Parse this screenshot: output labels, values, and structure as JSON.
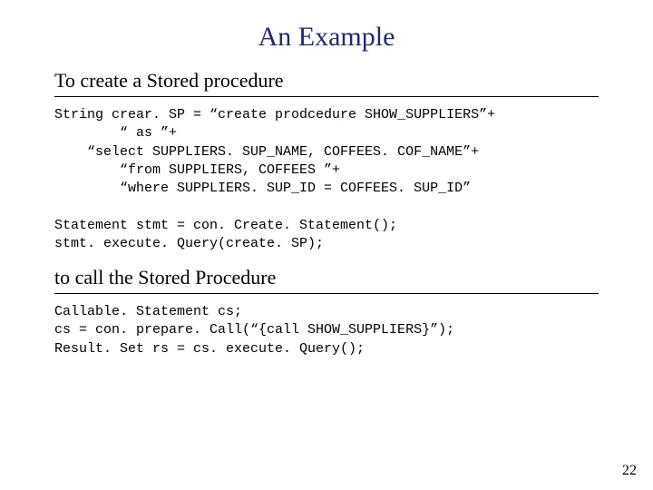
{
  "title": "An Example",
  "section1": {
    "heading": "To create a Stored procedure",
    "code": "String crear. SP = “create prodcedure SHOW_SUPPLIERS”+\n        “ as ”+\n    “select SUPPLIERS. SUP_NAME, COFFEES. COF_NAME”+\n        “from SUPPLIERS, COFFEES ”+\n        “where SUPPLIERS. SUP_ID = COFFEES. SUP_ID”\n\nStatement stmt = con. Create. Statement();\nstmt. execute. Query(create. SP);"
  },
  "section2": {
    "heading": "to call the Stored Procedure",
    "code": "Callable. Statement cs;\ncs = con. prepare. Call(“{call SHOW_SUPPLIERS}”);\nResult. Set rs = cs. execute. Query();"
  },
  "page_number": "22"
}
